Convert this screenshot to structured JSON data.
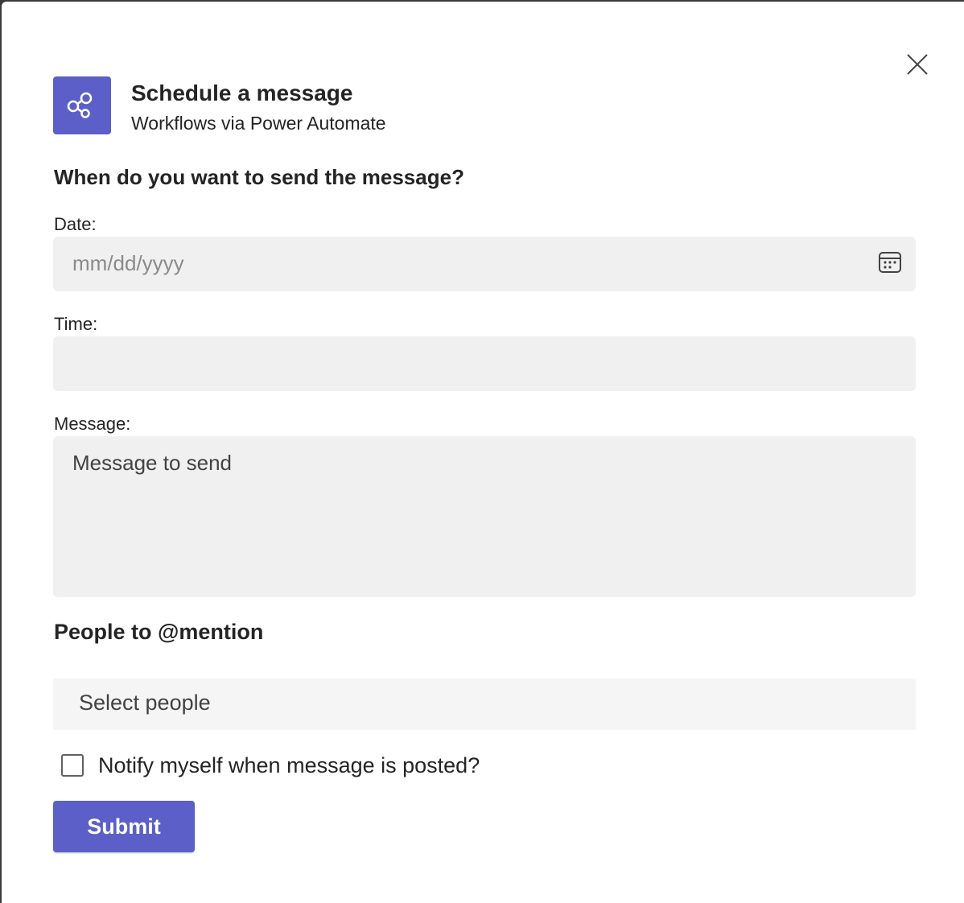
{
  "dialog": {
    "title": "Schedule a message",
    "subtitle": "Workflows via Power Automate",
    "app_icon": "share-nodes-icon",
    "close_icon": "close-icon"
  },
  "form": {
    "question": "When do you want to send the message?",
    "date_label": "Date:",
    "date_placeholder": "mm/dd/yyyy",
    "time_label": "Time:",
    "time_value": "",
    "message_label": "Message:",
    "message_placeholder": "Message to send",
    "mention_heading": "People to @mention",
    "people_placeholder": "Select people",
    "notify_label": "Notify myself when message is posted?",
    "notify_checked": false,
    "submit_label": "Submit"
  },
  "colors": {
    "accent": "#5b5fc7",
    "field_background": "#f0f0f0",
    "text": "#242424"
  }
}
